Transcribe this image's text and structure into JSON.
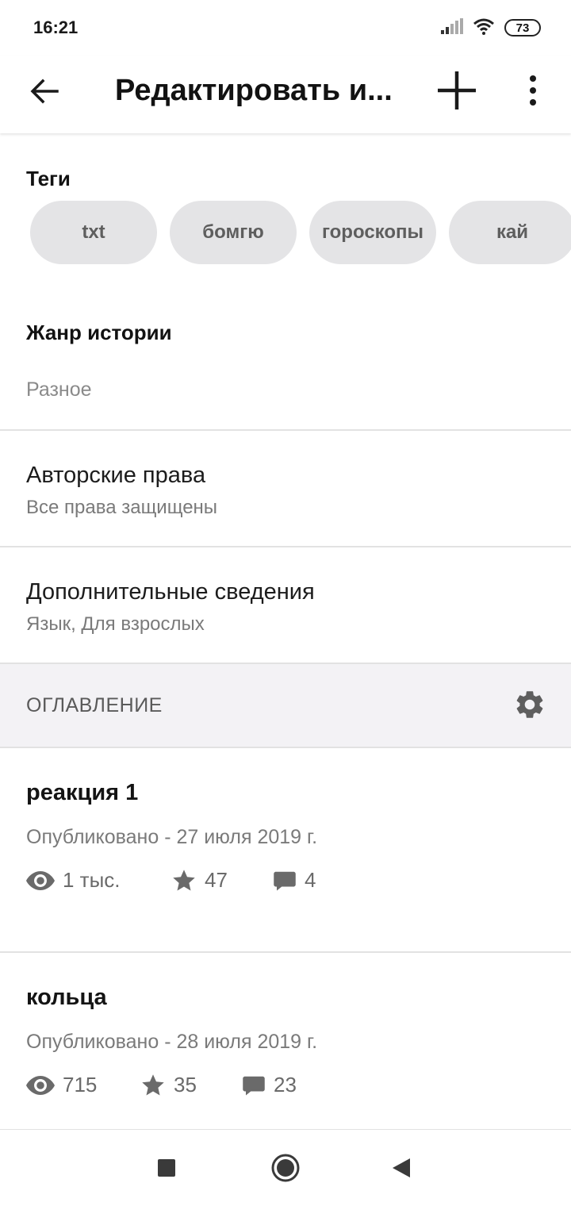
{
  "status_bar": {
    "time": "16:21",
    "battery": "73",
    "icons": [
      "signal-icon",
      "wifi-icon",
      "battery-icon"
    ]
  },
  "app_bar": {
    "title": "Редактировать и...",
    "icons": [
      "back-arrow-icon",
      "plus-icon",
      "more-vertical-icon"
    ]
  },
  "tags": {
    "label": "Теги",
    "items": [
      "txt",
      "бомгю",
      "гороскопы",
      "кай"
    ]
  },
  "genre": {
    "label": "Жанр истории",
    "value": "Разное"
  },
  "copyright": {
    "title": "Авторские права",
    "subtitle": "Все права защищены"
  },
  "details": {
    "title": "Дополнительные сведения",
    "subtitle": "Язык, Для взрослых"
  },
  "toc": {
    "title": "ОГЛАВЛЕНИЕ",
    "icon": "gear-icon"
  },
  "chapters": [
    {
      "title": "реакция 1",
      "published": "Опубликовано - 27 июля 2019 г.",
      "views": "1 тыс.",
      "votes": "47",
      "comments": "4"
    },
    {
      "title": "кольца",
      "published": "Опубликовано - 28 июля 2019 г.",
      "views": "715",
      "votes": "35",
      "comments": "23"
    }
  ],
  "nav_bar": {
    "icons": [
      "recents-square-icon",
      "home-circle-icon",
      "back-triangle-icon"
    ]
  },
  "colors": {
    "tag_bg": "#e4e4e6",
    "toc_bg": "#f3f2f5",
    "secondary_text": "#7a7a7a"
  }
}
